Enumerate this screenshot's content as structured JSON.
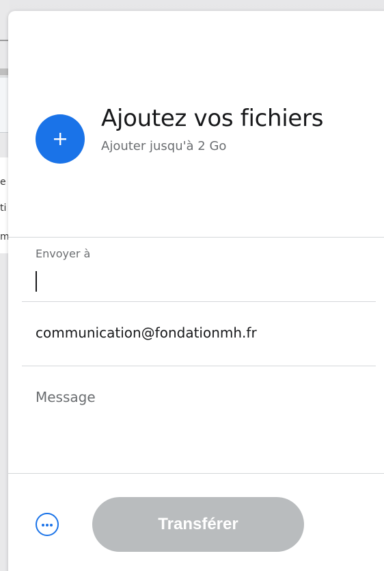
{
  "upload": {
    "title": "Ajoutez vos fichiers",
    "subtitle": "Ajouter jusqu'à 2 Go",
    "icon": "plus-icon"
  },
  "form": {
    "to_label": "Envoyer à",
    "to_value": "",
    "email_value": "communication@fondationmh.fr",
    "message_placeholder": "Message"
  },
  "footer": {
    "more_icon": "more-options-icon",
    "transfer_label": "Transférer"
  },
  "background": {
    "letters": [
      "e",
      "ti",
      "m"
    ]
  },
  "colors": {
    "accent": "#1a73e8",
    "button_disabled": "#b9bcbe",
    "text_primary": "#17181a",
    "text_secondary": "#6a6d70",
    "divider": "#d4d7d9"
  }
}
